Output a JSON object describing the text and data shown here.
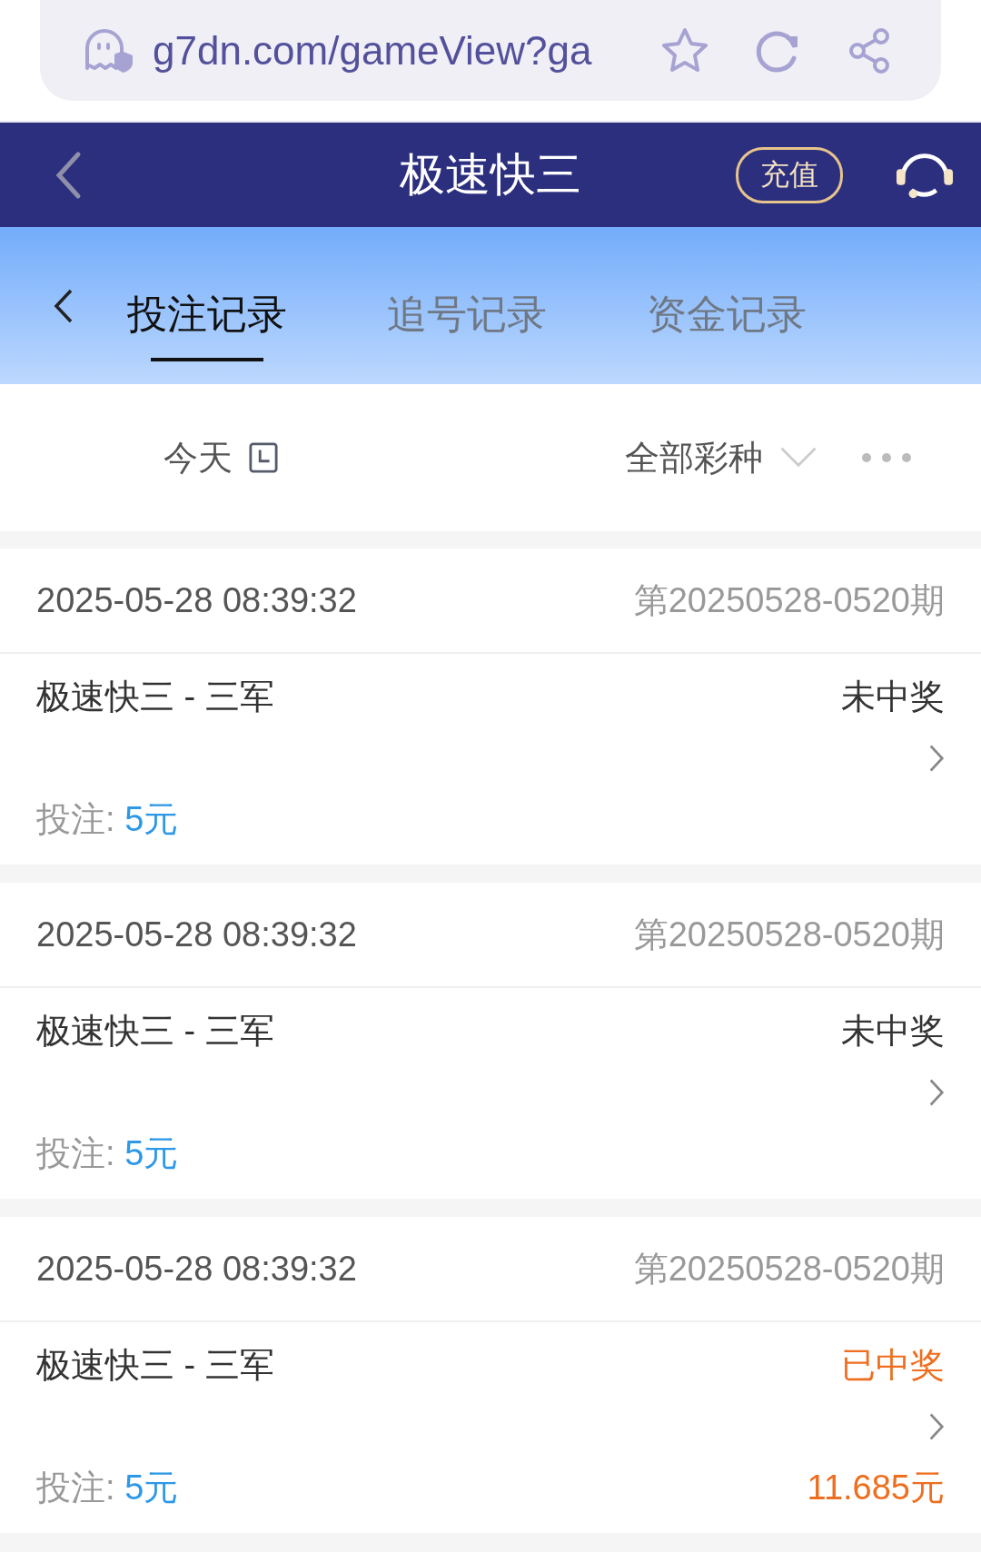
{
  "browser": {
    "url": "g7dn.com/gameView?ga"
  },
  "header": {
    "title": "极速快三",
    "recharge": "充值"
  },
  "tabs": [
    {
      "label": "投注记录",
      "selected": true
    },
    {
      "label": "追号记录",
      "selected": false
    },
    {
      "label": "资金记录",
      "selected": false
    }
  ],
  "filters": {
    "date": "今天",
    "lottery": "全部彩种"
  },
  "records": [
    {
      "time": "2025-05-28 08:39:32",
      "issue": "第20250528-0520期",
      "game": "极速快三 - 三军",
      "status": "未中奖",
      "won": false,
      "bet_label": "投注:",
      "bet": "5元"
    },
    {
      "time": "2025-05-28 08:39:32",
      "issue": "第20250528-0520期",
      "game": "极速快三 - 三军",
      "status": "未中奖",
      "won": false,
      "bet_label": "投注:",
      "bet": "5元"
    },
    {
      "time": "2025-05-28 08:39:32",
      "issue": "第20250528-0520期",
      "game": "极速快三 - 三军",
      "status": "已中奖",
      "won": true,
      "bet_label": "投注:",
      "bet": "5元",
      "prize": "11.685元"
    }
  ]
}
